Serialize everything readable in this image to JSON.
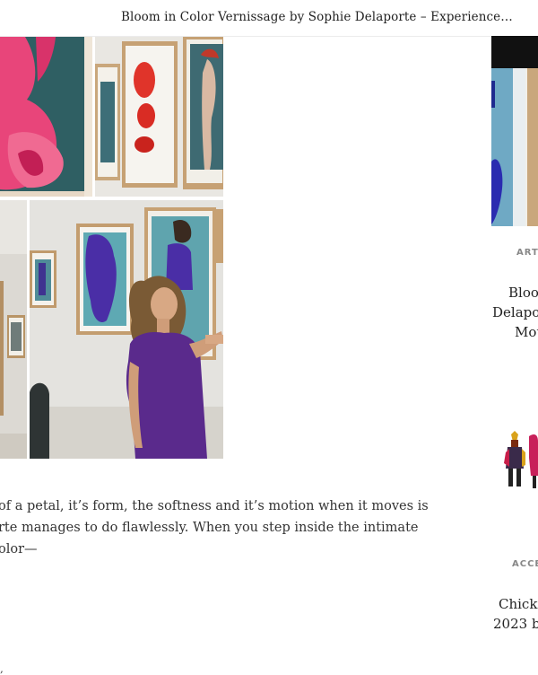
{
  "header": {
    "title": "Bloom in Color Vernissage by Sophie Delaporte – Experience…"
  },
  "article": {
    "paragraph_lines": [
      "of a petal, it’s form, the softness and it’s motion when it moves is",
      "rte manages to do flawlessly. When you step inside the intimate",
      "olor—"
    ],
    "trailing_mark": ","
  },
  "sidebar": {
    "cards": [
      {
        "category": "ART,",
        "title_lines": [
          "Bloor",
          "Delapo",
          "Mot"
        ]
      },
      {
        "category": "ACCE",
        "title_lines": [
          "Chick",
          "2023 b"
        ]
      }
    ]
  }
}
